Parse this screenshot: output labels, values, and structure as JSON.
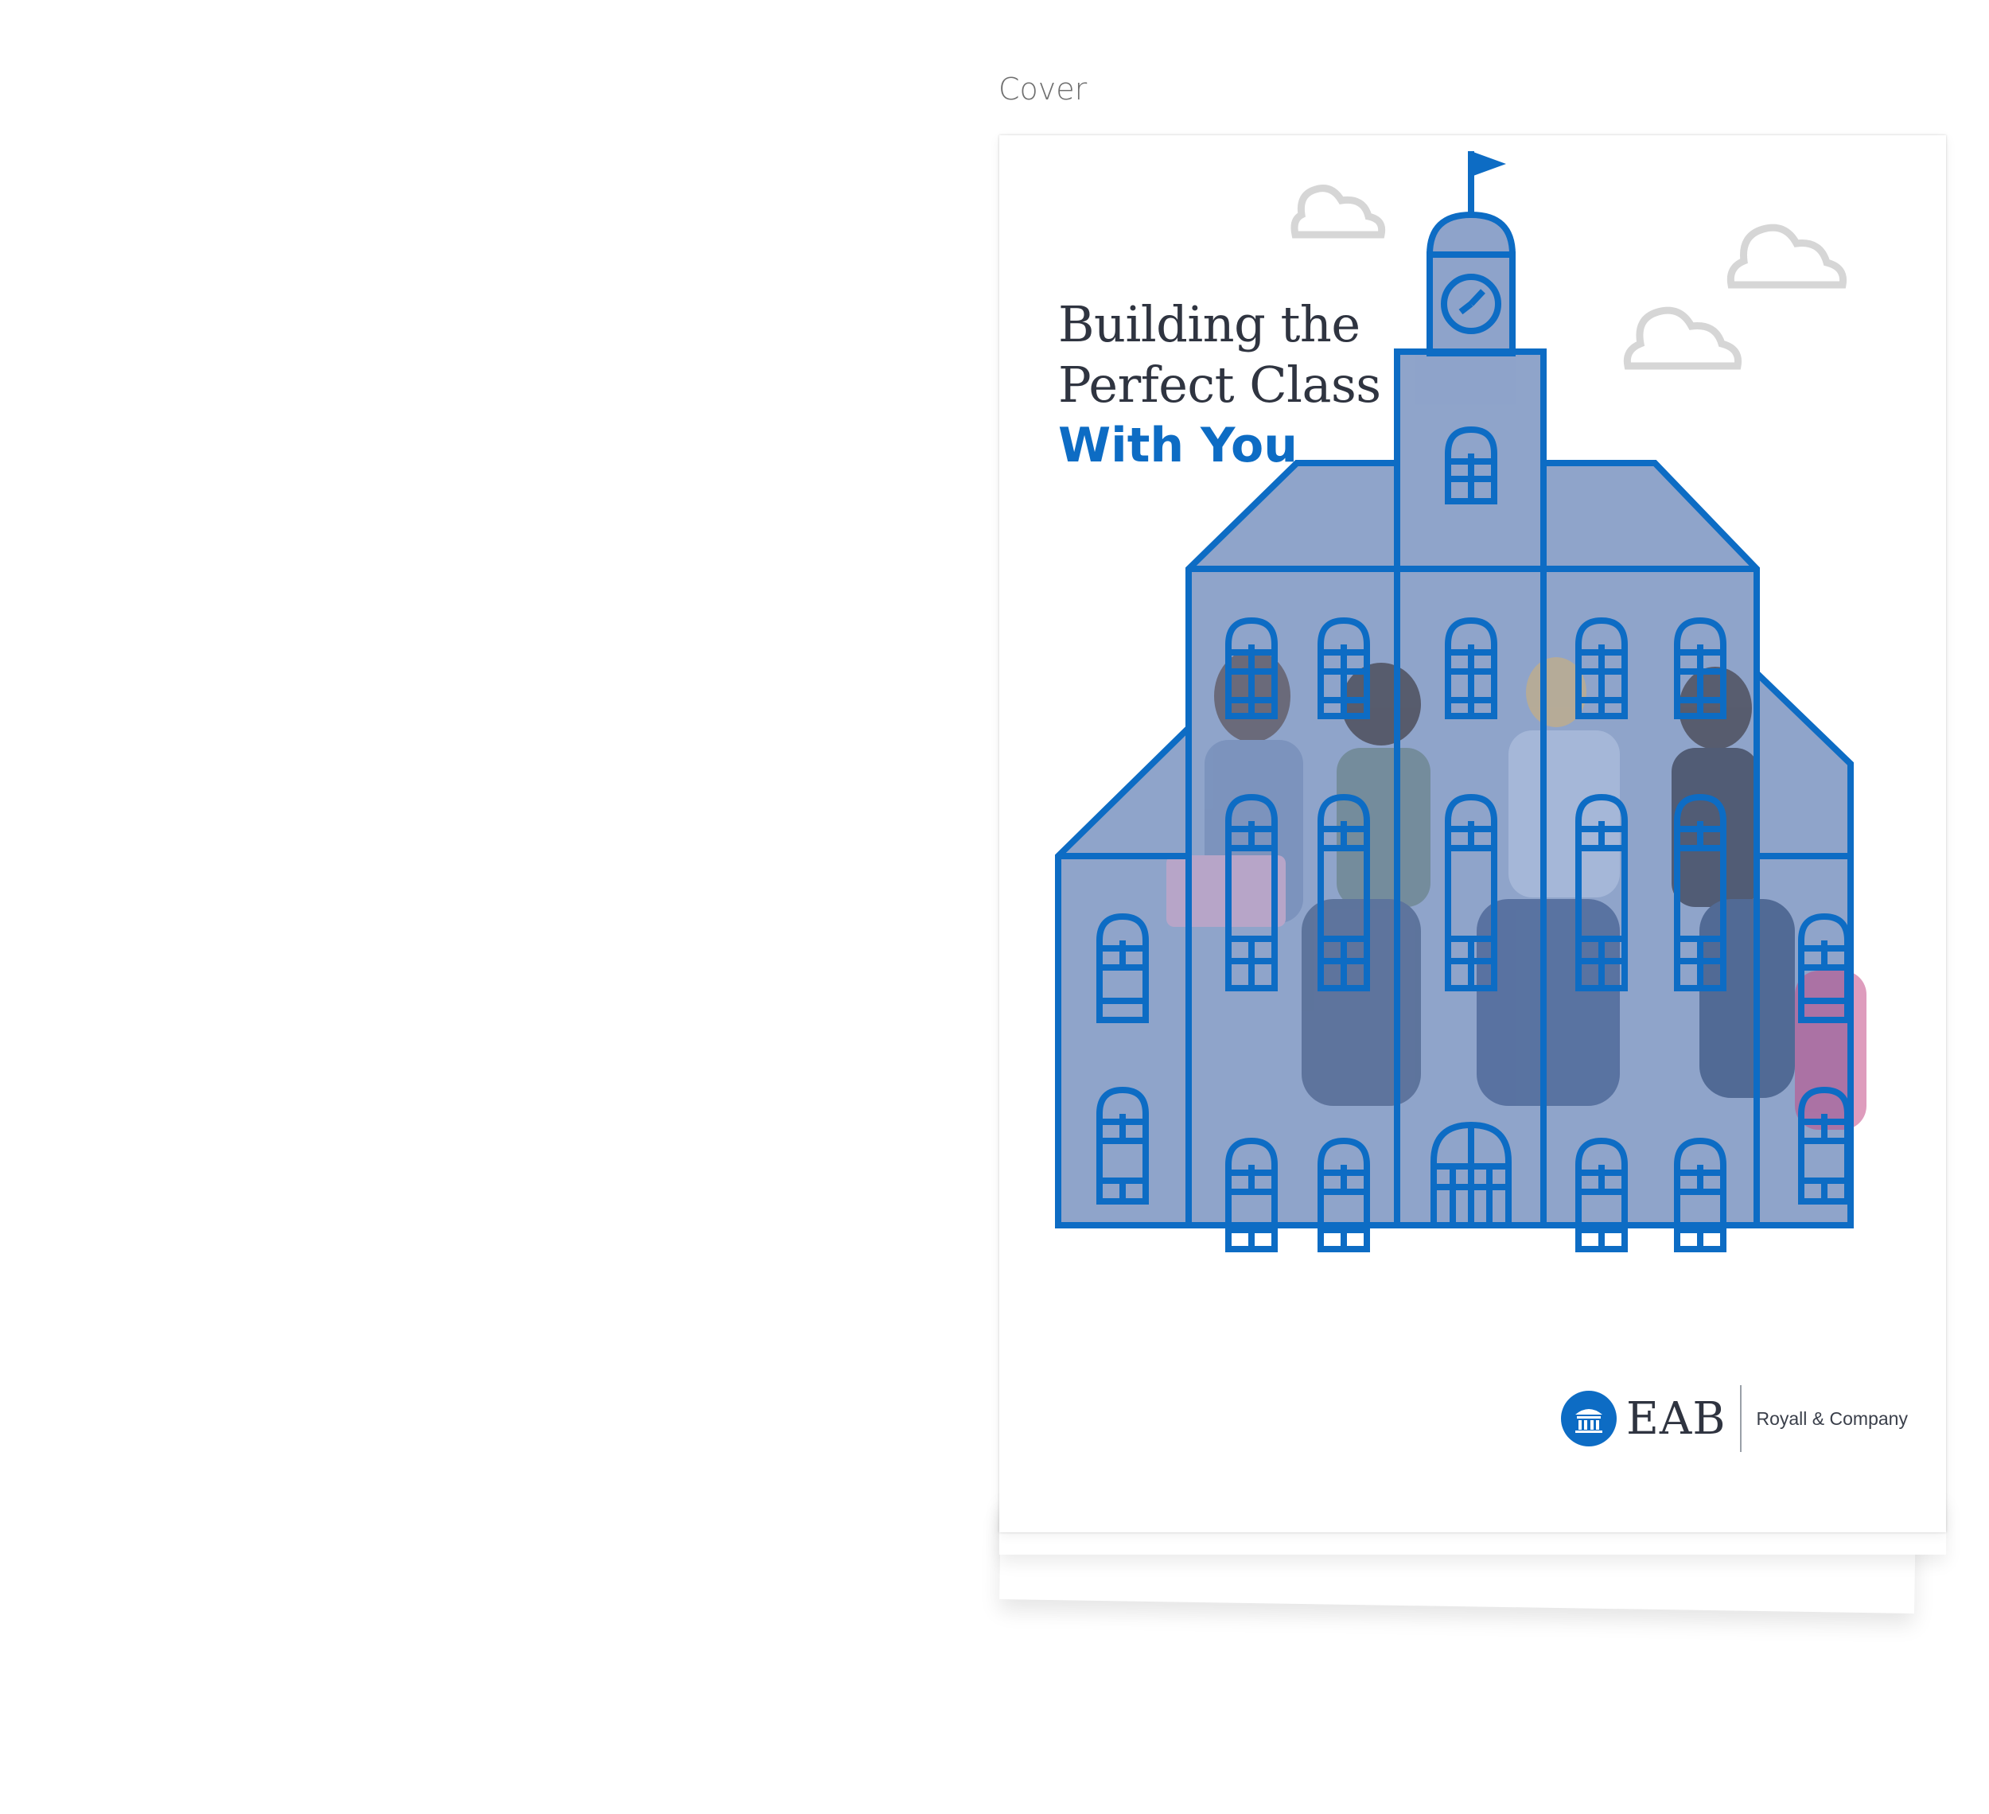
{
  "caption": "Cover",
  "cover": {
    "title_line_1": "Building the",
    "title_line_2": "Perfect Class",
    "title_accent": "With You",
    "illustration_icon": "schoolhouse-with-students-icon"
  },
  "logo": {
    "mark_icon": "pillared-building-icon",
    "brand": "EAB",
    "company": "Royall & Company"
  },
  "colors": {
    "accent_blue": "#0d6cc4",
    "building_fill": "#8aa0c8",
    "title_text": "#2f3440",
    "cloud": "#d6d6d6"
  }
}
